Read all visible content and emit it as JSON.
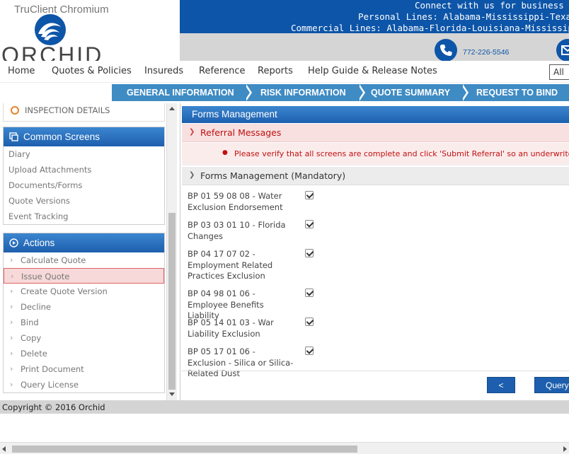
{
  "window": {
    "title": "TruClient Chromium"
  },
  "logo": {
    "text": "ORCHID"
  },
  "banner": {
    "line1": "Connect with us for business in t",
    "line2": "Personal Lines: Alabama-Mississippi-Texas (G",
    "line3": "Commercial Lines: Alabama-Florida-Louisiana-Mississippi-Ne"
  },
  "contact": {
    "phone": "772-226-5546",
    "phone_icon": "phone-icon",
    "mail_icon": "mail-icon"
  },
  "nav": {
    "items": [
      "Home",
      "Quotes & Policies",
      "Insureds",
      "Reference",
      "Reports",
      "Help Guide & Release Notes"
    ],
    "select_value": "All"
  },
  "steps": [
    "GENERAL INFORMATION",
    "RISK INFORMATION",
    "QUOTE SUMMARY",
    "REQUEST TO BIND"
  ],
  "sidebar": {
    "inspection_label": "INSPECTION DETAILS",
    "common_screens": {
      "title": "Common Screens",
      "items": [
        "Diary",
        "Upload Attachments",
        "Documents/Forms",
        "Quote Versions",
        "Event Tracking"
      ]
    },
    "actions": {
      "title": "Actions",
      "items": [
        "Calculate Quote",
        "Issue Quote",
        "Create Quote Version",
        "Decline",
        "Bind",
        "Copy",
        "Delete",
        "Print Document",
        "Query License"
      ],
      "highlighted": "Issue Quote"
    }
  },
  "content": {
    "title": "Forms Management",
    "referral": {
      "title": "Referral Messages",
      "message": "Please verify that all screens are complete and click 'Submit Referral' so an underwriter can"
    },
    "forms": {
      "title": "Forms Management (Mandatory)",
      "items": [
        {
          "label": "BP 01 59 08 08 - Water Exclusion Endorsement",
          "checked": true
        },
        {
          "label": "BP 03 03 01 10 - Florida Changes",
          "checked": true
        },
        {
          "label": "BP 04 17 07 02 - Employment Related Practices Exclusion",
          "checked": true
        },
        {
          "label": "BP 04 98 01 06 - Employee Benefits Liability",
          "checked": true
        },
        {
          "label": "BP 05 14 01 03 - War Liability Exclusion",
          "checked": true
        },
        {
          "label": "BP 05 17 01 06 - Exclusion - Silica or Silica-Related Dust",
          "checked": true
        }
      ]
    },
    "back_button": "<",
    "query_button": "Query"
  },
  "footer": {
    "copyright": "Copyright © 2016 Orchid"
  },
  "colors": {
    "brand_blue": "#0d55a8",
    "step_blue": "#3f8bc4",
    "error_red": "#c01010"
  }
}
